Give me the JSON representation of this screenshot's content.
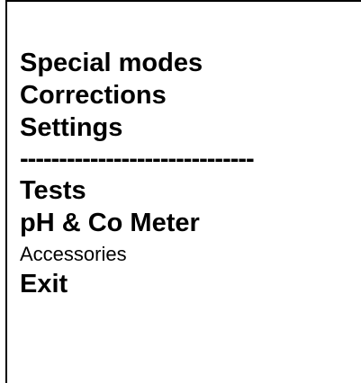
{
  "menu": {
    "items": [
      {
        "label": "Special modes"
      },
      {
        "label": "Corrections"
      },
      {
        "label": "Settings"
      },
      {
        "label": "------------------------------"
      },
      {
        "label": "Tests"
      },
      {
        "label": "pH & Co Meter"
      },
      {
        "label": "Accessories"
      },
      {
        "label": "Exit"
      }
    ]
  },
  "colors": {
    "background": "#ffffff",
    "text": "#000000",
    "border": "#000000"
  }
}
